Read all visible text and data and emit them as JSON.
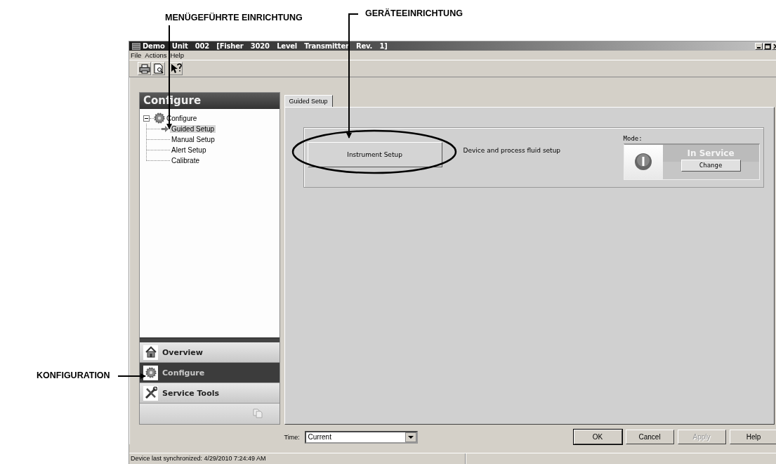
{
  "annotations": [
    {
      "label": "MENÜGEFÜHRTE EINRICHTUNG"
    },
    {
      "label": "GERÄTEEINRICHTUNG"
    },
    {
      "label": "KONFIGURATION"
    }
  ],
  "window": {
    "title": "Demo Unit 002 [Fisher 3020 Level Transmitter Rev. 1]"
  },
  "menu": [
    "File",
    "Actions",
    "Help"
  ],
  "sidebar": {
    "title": "Configure",
    "tree": {
      "label": "Configure",
      "expanded": true,
      "children": [
        {
          "label": "Guided Setup",
          "selected": true
        },
        {
          "label": "Manual Setup",
          "selected": false
        },
        {
          "label": "Alert Setup",
          "selected": false
        },
        {
          "label": "Calibrate",
          "selected": false
        }
      ]
    },
    "nav": [
      {
        "label": "Overview",
        "kind": "home",
        "selected": false
      },
      {
        "label": "Configure",
        "kind": "gear",
        "selected": true
      },
      {
        "label": "Service Tools",
        "kind": "tools",
        "selected": false
      }
    ]
  },
  "tabs": [
    {
      "label": "Guided Setup",
      "selected": true
    }
  ],
  "guided_setup": {
    "button": "Instrument Setup",
    "description": "Device and process fluid setup"
  },
  "mode": {
    "label": "Mode:",
    "status": "In Service",
    "button": "Change"
  },
  "time": {
    "label": "Time:",
    "value": "Current"
  },
  "buttons": [
    {
      "label": "OK",
      "disabled": false
    },
    {
      "label": "Cancel",
      "disabled": false
    },
    {
      "label": "Apply",
      "disabled": true
    },
    {
      "label": "Help",
      "disabled": false
    }
  ],
  "status_bar": {
    "text": "Device last synchronized: 4/29/2010 7:24:49 AM"
  }
}
